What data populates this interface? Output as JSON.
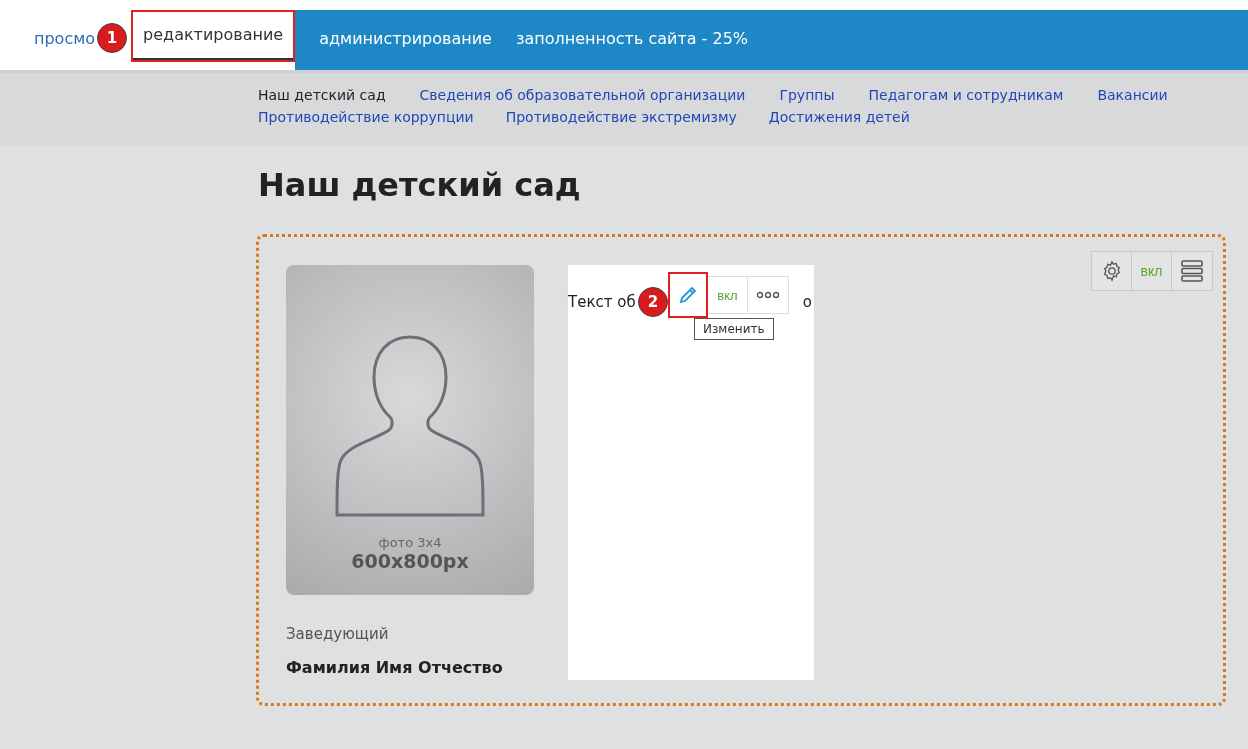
{
  "top_tabs": [
    {
      "label": "просмо",
      "selected": false,
      "highlight": false
    },
    {
      "label": "редактирование",
      "selected": true,
      "highlight": true
    },
    {
      "label": "администрирование",
      "selected": false,
      "highlight": false
    },
    {
      "label": "заполненность сайта - 25%",
      "selected": false,
      "highlight": false
    }
  ],
  "callouts": [
    "1",
    "2"
  ],
  "nav": {
    "rows": [
      [
        {
          "label": "Наш детский сад",
          "selected": true
        },
        {
          "label": "Сведения об образовательной организации",
          "selected": false
        },
        {
          "label": "Группы",
          "selected": false
        },
        {
          "label": "Педагогам и сотрудникам",
          "selected": false
        },
        {
          "label": "Вакансии",
          "selected": false
        }
      ],
      [
        {
          "label": "Противодействие коррупции",
          "selected": false
        },
        {
          "label": "Противодействие экстремизму",
          "selected": false
        },
        {
          "label": "Достижения детей",
          "selected": false
        }
      ]
    ]
  },
  "page_title": "Наш детский сад",
  "block_toolbar": {
    "toggle": "вкл"
  },
  "photo": {
    "caption": "фото 3х4",
    "size": "600x800px"
  },
  "person": {
    "role": "Заведующий",
    "name": "Фамилия Имя Отчество"
  },
  "text_block": {
    "text_start": "Текст об",
    "text_end": "о",
    "toolbar": {
      "toggle": "вкл"
    },
    "tooltip": "Изменить"
  }
}
